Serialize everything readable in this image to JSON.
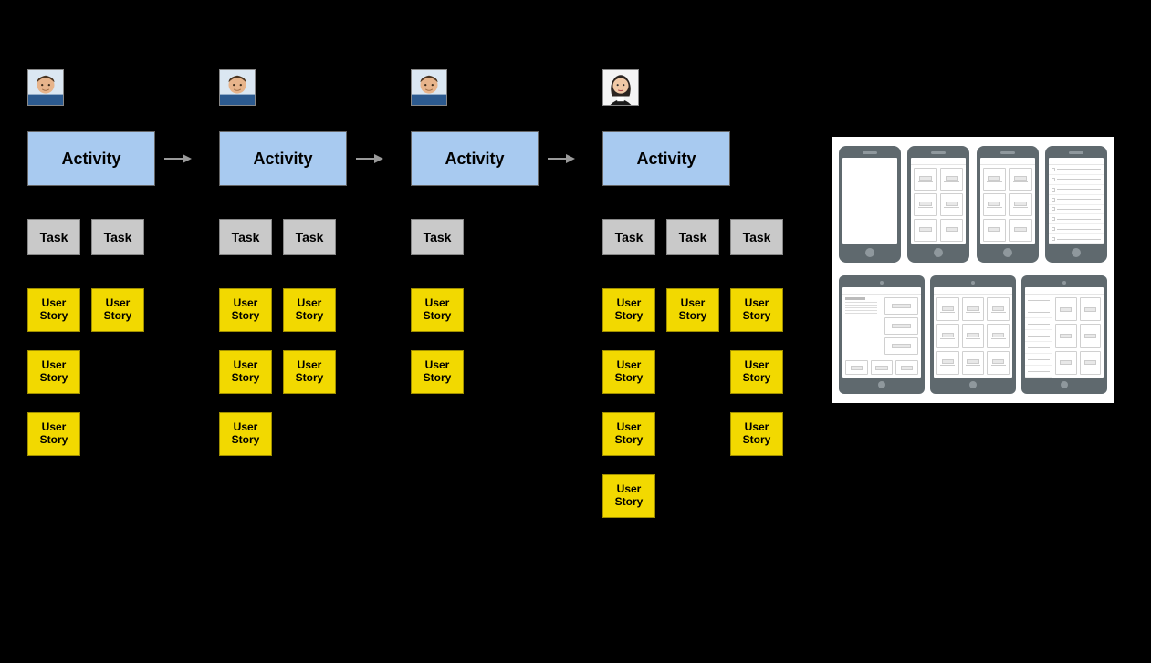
{
  "labels": {
    "activity": "Activity",
    "task": "Task",
    "user_story": "User\nStory"
  },
  "personas": {
    "male": "male",
    "female": "female"
  },
  "columns": [
    {
      "persona": "male",
      "activity_label_ref": "activity",
      "arrow_after": true,
      "tasks": 2,
      "story_columns": [
        3,
        1
      ]
    },
    {
      "persona": "male",
      "activity_label_ref": "activity",
      "arrow_after": true,
      "tasks": 2,
      "story_columns": [
        3,
        2
      ]
    },
    {
      "persona": "male",
      "activity_label_ref": "activity",
      "arrow_after": true,
      "tasks": 1,
      "story_columns": [
        2
      ]
    },
    {
      "persona": "female",
      "activity_label_ref": "activity",
      "arrow_after": false,
      "tasks": 3,
      "story_columns": [
        4,
        1,
        3
      ]
    }
  ],
  "wireframes": {
    "row1_phones": [
      {
        "variant": "blank"
      },
      {
        "variant": "grid"
      },
      {
        "variant": "grid"
      },
      {
        "variant": "list"
      }
    ],
    "row2_tablets": [
      {
        "variant": "text-grid"
      },
      {
        "variant": "grid"
      },
      {
        "variant": "list-grid"
      }
    ]
  },
  "colors": {
    "background": "#000000",
    "activity_card": "#a8caf0",
    "task_card": "#c9c9c9",
    "story_card": "#f2d900",
    "device_body": "#5f696e"
  }
}
